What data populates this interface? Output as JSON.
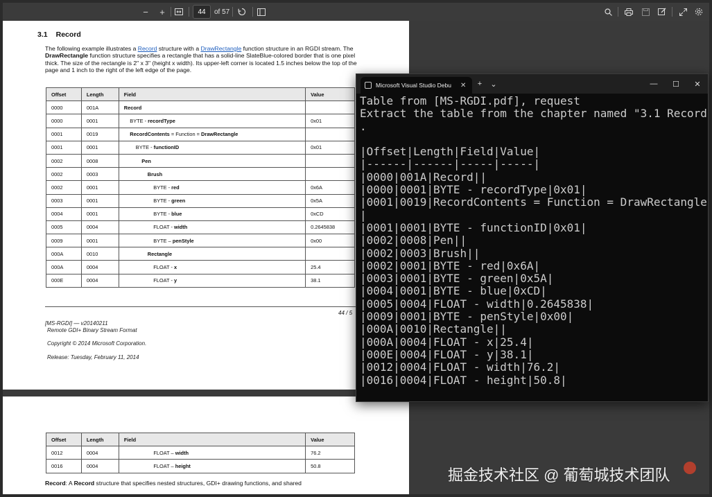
{
  "toolbar": {
    "zoom_out": "−",
    "zoom_in": "+",
    "page_current": "44",
    "page_total": "of 57"
  },
  "doc": {
    "section_number": "3.1",
    "section_title": "Record",
    "para_prefix": "The following example illustrates a ",
    "para_link1": "Record",
    "para_mid1": " structure with a ",
    "para_link2": "DrawRectangle",
    "para_mid2": " function structure in an RGDI stream. The ",
    "para_bold": "DrawRectangle",
    "para_rest": " function structure specifies a rectangle that has a solid-line SlateBlue-colored border that is one pixel thick. The size of the rectangle is 2\" x 3\" (height x width). Its upper-left corner is located 1.5 inches below the top of the page and 1 inch to the right of the left edge of the page.",
    "table_headers": [
      "Offset",
      "Length",
      "Field",
      "Value"
    ],
    "rows_page1": [
      {
        "offset": "0000",
        "length": "001A",
        "indent": 0,
        "field_pre": "",
        "field_bold": "Record",
        "field_post": "",
        "value": ""
      },
      {
        "offset": "0000",
        "length": "0001",
        "indent": 1,
        "field_pre": "BYTE - ",
        "field_bold": "recordType",
        "field_post": "",
        "value": "0x01"
      },
      {
        "offset": "0001",
        "length": "0019",
        "indent": 1,
        "field_pre": "",
        "field_bold": "RecordContents",
        "field_post": " = Function = ",
        "field_bold2": "DrawRectangle",
        "value": ""
      },
      {
        "offset": "0001",
        "length": "0001",
        "indent": 2,
        "field_pre": "BYTE - ",
        "field_bold": "functionID",
        "field_post": "",
        "value": "0x01"
      },
      {
        "offset": "0002",
        "length": "0008",
        "indent": 3,
        "field_pre": "",
        "field_bold": "Pen",
        "field_post": "",
        "value": ""
      },
      {
        "offset": "0002",
        "length": "0003",
        "indent": 4,
        "field_pre": "",
        "field_bold": "Brush",
        "field_post": "",
        "value": ""
      },
      {
        "offset": "0002",
        "length": "0001",
        "indent": 5,
        "field_pre": "BYTE - ",
        "field_bold": "red",
        "field_post": "",
        "value": "0x6A"
      },
      {
        "offset": "0003",
        "length": "0001",
        "indent": 5,
        "field_pre": "BYTE - ",
        "field_bold": "green",
        "field_post": "",
        "value": "0x5A"
      },
      {
        "offset": "0004",
        "length": "0001",
        "indent": 5,
        "field_pre": "BYTE - ",
        "field_bold": "blue",
        "field_post": "",
        "value": "0xCD"
      },
      {
        "offset": "0005",
        "length": "0004",
        "indent": 5,
        "field_pre": "FLOAT - ",
        "field_bold": "width",
        "field_post": "",
        "value": "0.2645838"
      },
      {
        "offset": "0009",
        "length": "0001",
        "indent": 5,
        "field_pre": "BYTE – ",
        "field_bold": "penStyle",
        "field_post": "",
        "value": "0x00"
      },
      {
        "offset": "000A",
        "length": "0010",
        "indent": 4,
        "field_pre": "",
        "field_bold": "Rectangle",
        "field_post": "",
        "value": ""
      },
      {
        "offset": "000A",
        "length": "0004",
        "indent": 5,
        "field_pre": "FLOAT - ",
        "field_bold": "x",
        "field_post": "",
        "value": "25.4"
      },
      {
        "offset": "000E",
        "length": "0004",
        "indent": 5,
        "field_pre": "FLOAT - ",
        "field_bold": "y",
        "field_post": "",
        "value": "38.1"
      }
    ],
    "rows_page2": [
      {
        "offset": "0012",
        "length": "0004",
        "indent": 5,
        "field_pre": "FLOAT – ",
        "field_bold": "width",
        "field_post": "",
        "value": "76.2"
      },
      {
        "offset": "0016",
        "length": "0004",
        "indent": 5,
        "field_pre": "FLOAT – ",
        "field_bold": "height",
        "field_post": "",
        "value": "50.8"
      }
    ],
    "page_number": "44 / 5",
    "footer_doc": "[MS-RGDI] — v20140211",
    "footer_title": "Remote GDI+ Binary Stream Format",
    "footer_copyright": "Copyright © 2014 Microsoft Corporation.",
    "footer_release": "Release: Tuesday, February 11, 2014",
    "page2_bold1": "Record",
    "page2_text1": ": A ",
    "page2_bold2": "Record",
    "page2_text2": " structure that specifies nested structures, GDI+ drawing functions, and shared"
  },
  "terminal": {
    "tab_title": "Microsoft Visual Studio Debu",
    "new_tab": "+",
    "dropdown": "⌄",
    "minimize": "—",
    "maximize": "☐",
    "close": "✕",
    "lines": [
      "Table from [MS-RGDI.pdf], request",
      "Extract the table from the chapter named \"3.1 Record\"",
      ".",
      "",
      "|Offset|Length|Field|Value|",
      "|------|------|-----|-----|",
      "|0000|001A|Record||",
      "|0000|0001|BYTE - recordType|0x01|",
      "|0001|0019|RecordContents = Function = DrawRectangle|",
      "|",
      "|0001|0001|BYTE - functionID|0x01|",
      "|0002|0008|Pen||",
      "|0002|0003|Brush||",
      "|0002|0001|BYTE - red|0x6A|",
      "|0003|0001|BYTE - green|0x5A|",
      "|0004|0001|BYTE - blue|0xCD|",
      "|0005|0004|FLOAT - width|0.2645838|",
      "|0009|0001|BYTE - penStyle|0x00|",
      "|000A|0010|Rectangle||",
      "|000A|0004|FLOAT - x|25.4|",
      "|000E|0004|FLOAT - y|38.1|",
      "|0012|0004|FLOAT - width|76.2|",
      "|0016|0004|FLOAT - height|50.8|"
    ]
  },
  "watermark": "掘金技术社区 @ 葡萄城技术团队"
}
